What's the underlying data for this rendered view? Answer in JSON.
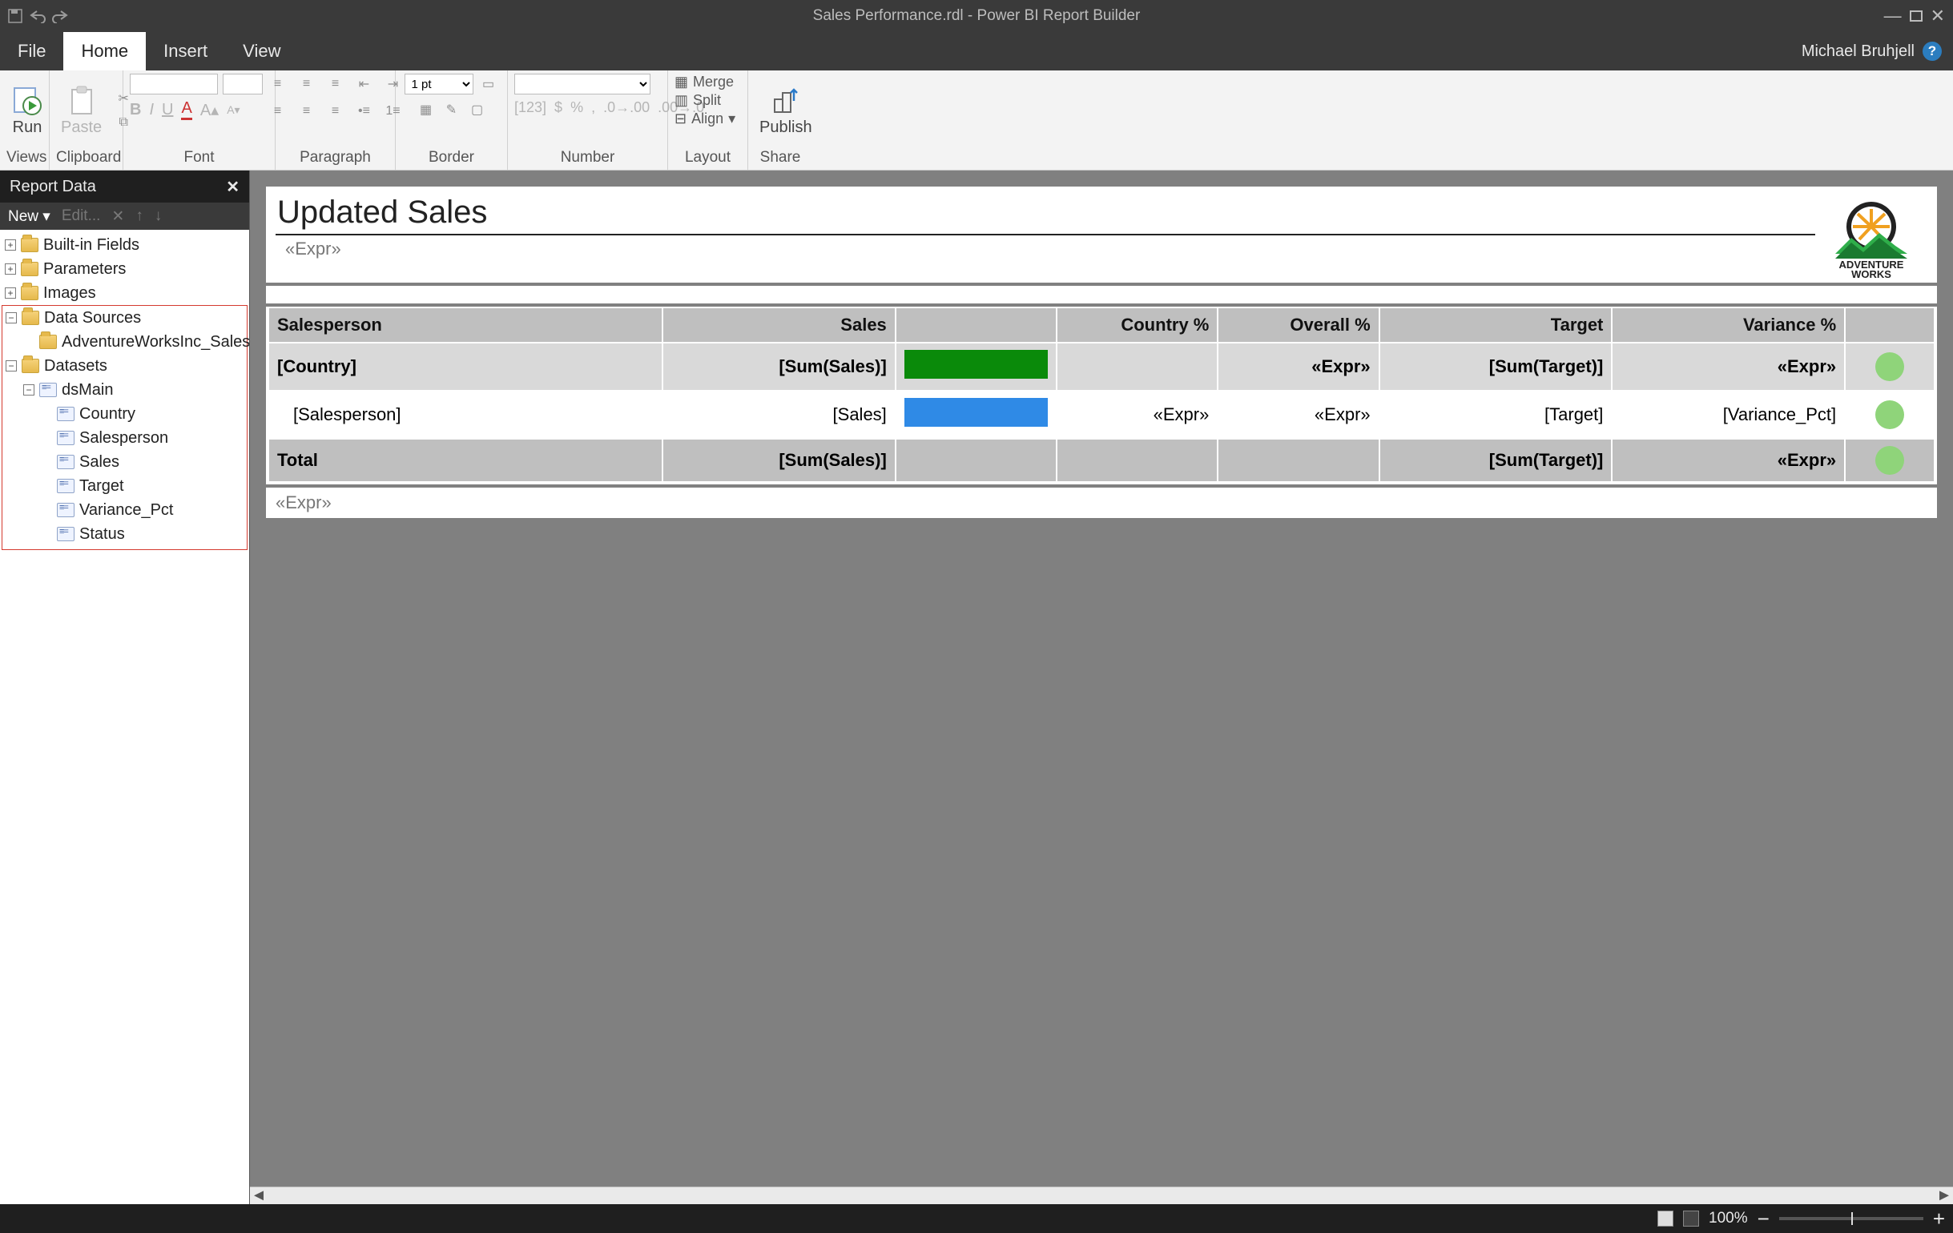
{
  "title": "Sales Performance.rdl - Power BI Report Builder",
  "user": "Michael Bruhjell",
  "menutabs": [
    "File",
    "Home",
    "Insert",
    "View"
  ],
  "active_tab": "Home",
  "ribbon": {
    "groups": [
      "Views",
      "Clipboard",
      "Font",
      "Paragraph",
      "Border",
      "Number",
      "Layout",
      "Share"
    ],
    "run": "Run",
    "paste": "Paste",
    "border_width": "1 pt",
    "layout": {
      "merge": "Merge",
      "split": "Split",
      "align": "Align"
    },
    "publish": "Publish"
  },
  "pane": {
    "title": "Report Data",
    "toolbar": {
      "new": "New",
      "edit": "Edit..."
    },
    "nodes": {
      "builtin": "Built-in Fields",
      "parameters": "Parameters",
      "images": "Images",
      "datasources": "Data Sources",
      "datasource1": "AdventureWorksInc_SalesAnalysis",
      "datasets": "Datasets",
      "dsmain": "dsMain",
      "fields": [
        "Country",
        "Salesperson",
        "Sales",
        "Target",
        "Variance_Pct",
        "Status"
      ]
    }
  },
  "report": {
    "title": "Updated Sales",
    "expr": "«Expr»",
    "logo_brand": "ADVENTURE",
    "logo_brand2": "WORKS",
    "headers": [
      "Salesperson",
      "Sales",
      "",
      "Country %",
      "Overall %",
      "Target",
      "Variance %",
      ""
    ],
    "group_row": [
      "[Country]",
      "[Sum(Sales)]",
      "",
      "",
      "«Expr»",
      "[Sum(Target)]",
      "«Expr»",
      ""
    ],
    "detail_row": [
      "[Salesperson]",
      "[Sales]",
      "",
      "«Expr»",
      "«Expr»",
      "[Target]",
      "[Variance_Pct]",
      ""
    ],
    "total_row": [
      "Total",
      "[Sum(Sales)]",
      "",
      "",
      "",
      "[Sum(Target)]",
      "«Expr»",
      ""
    ]
  },
  "status": {
    "zoom": "100%"
  }
}
